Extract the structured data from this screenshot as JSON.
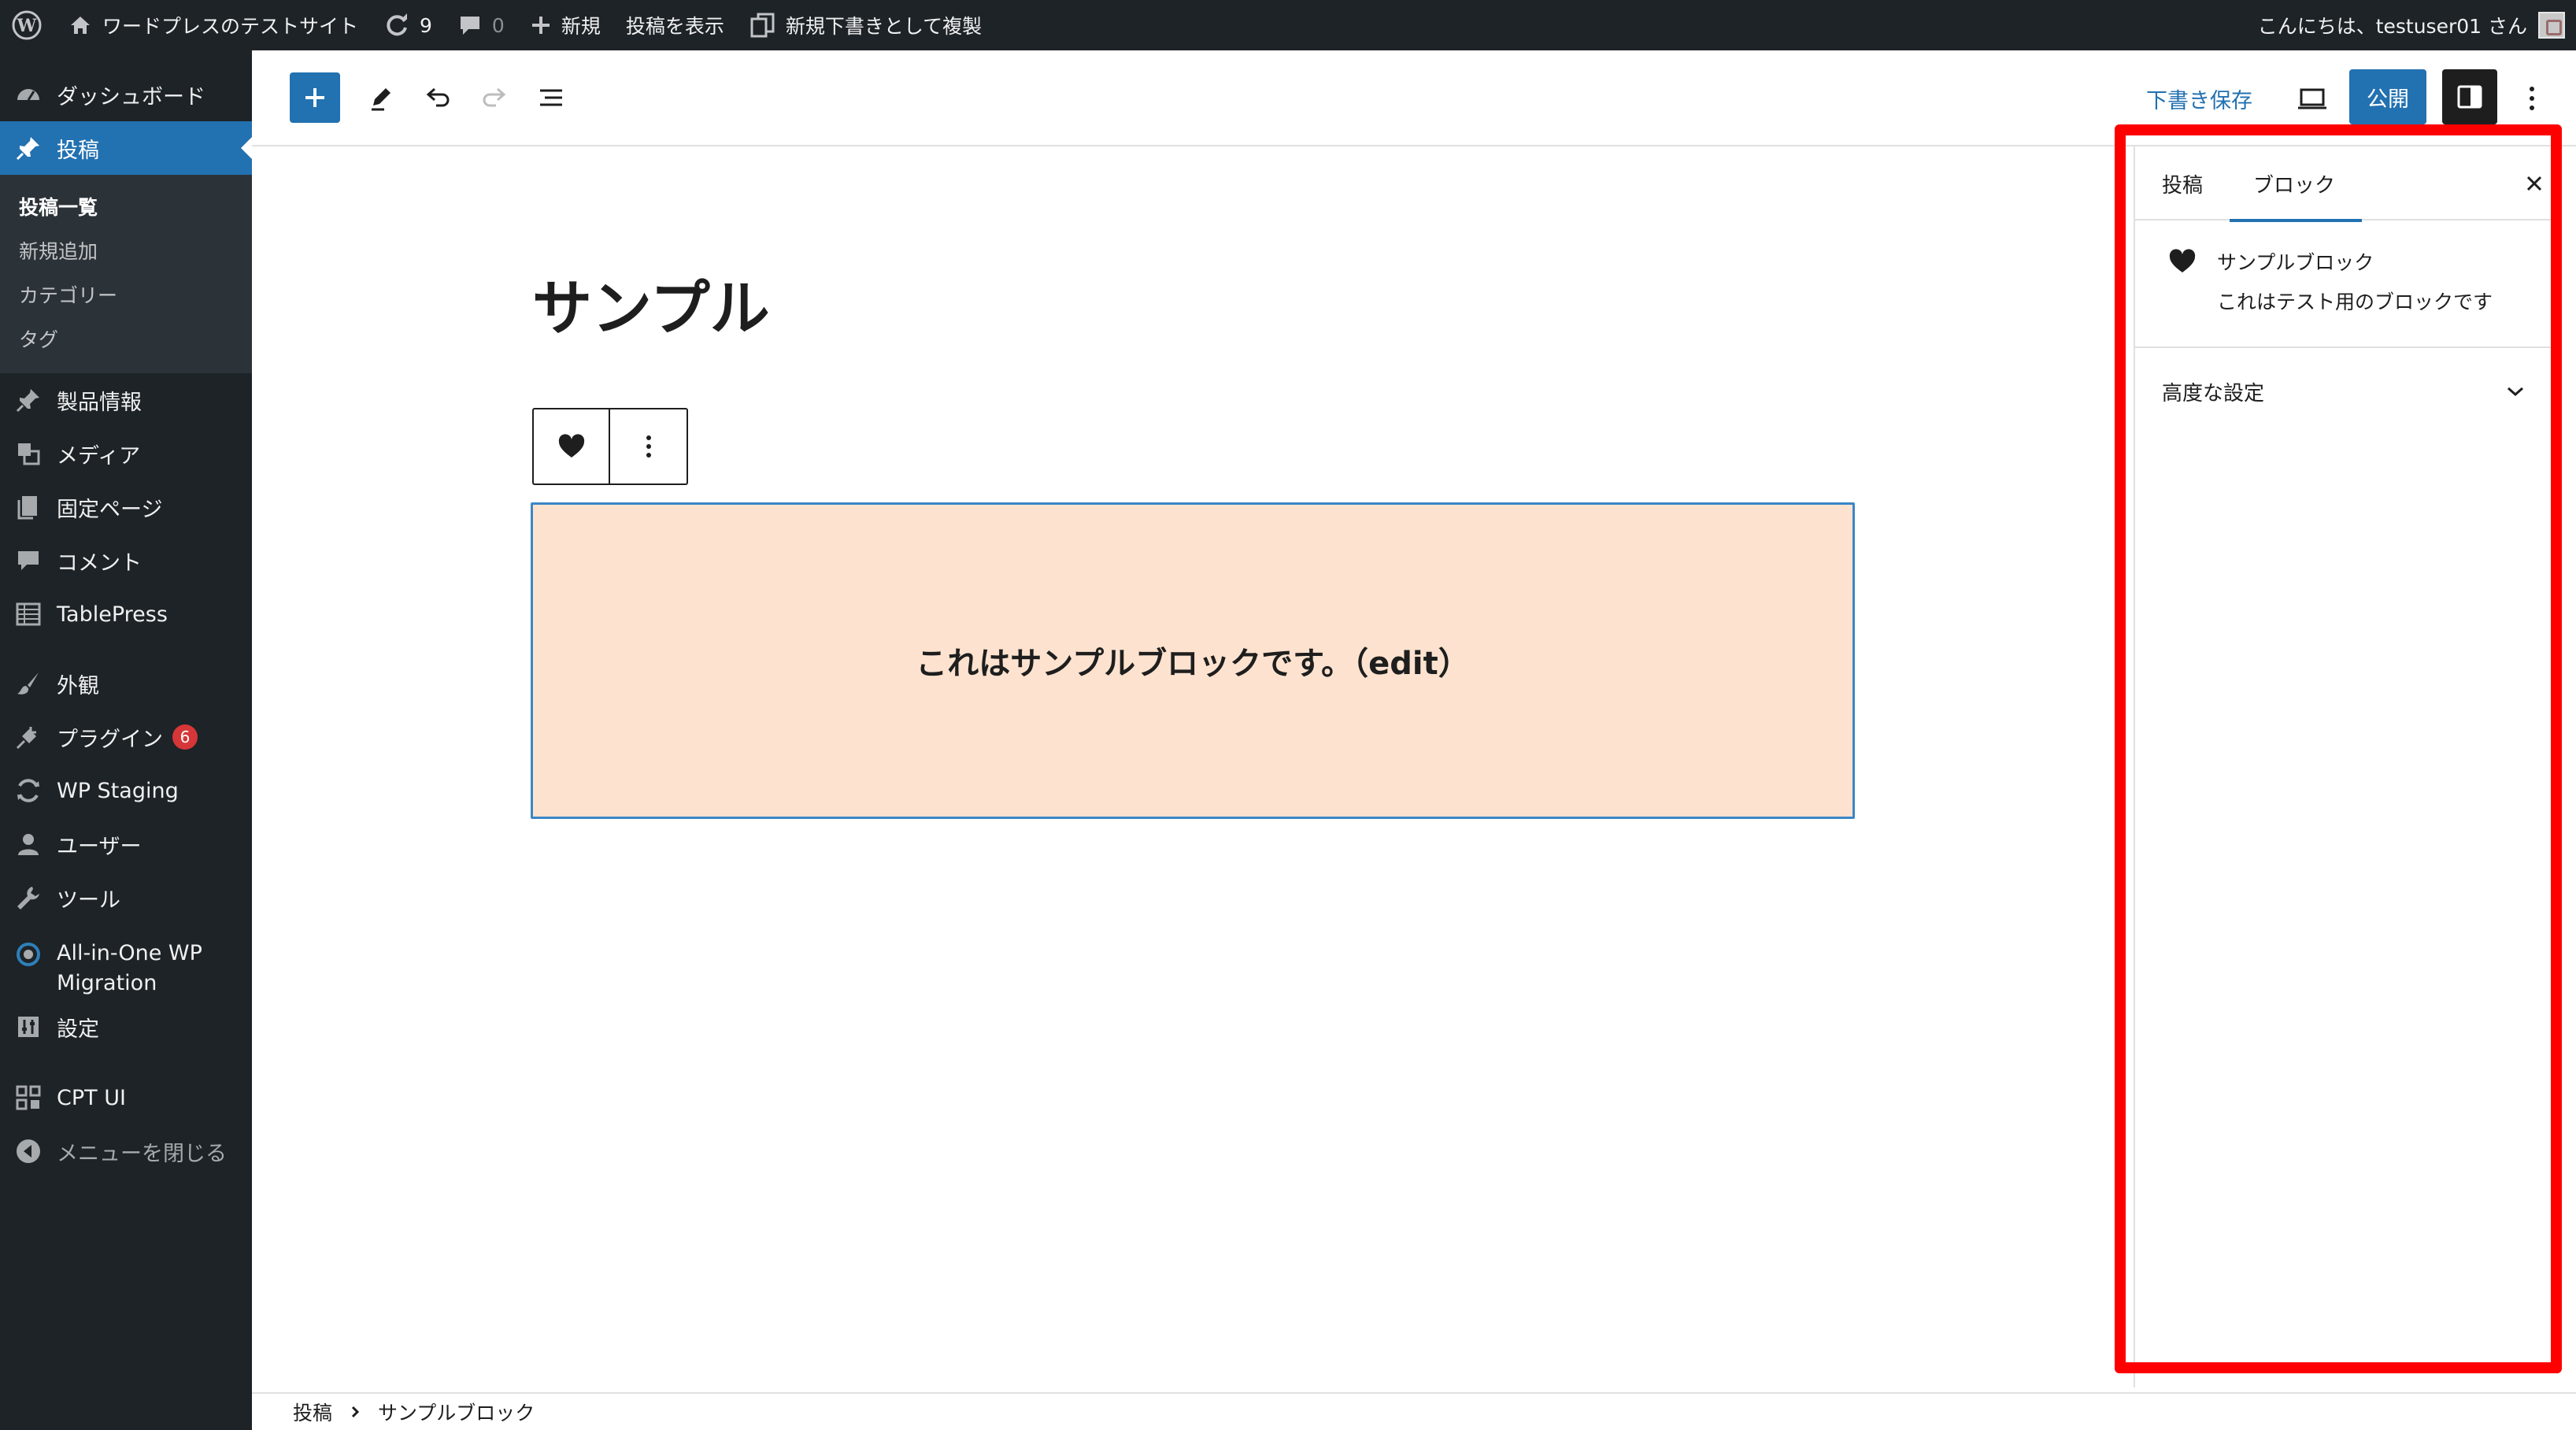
{
  "admin_bar": {
    "site_name": "ワードプレスのテストサイト",
    "updates_count": "9",
    "comments_count": "0",
    "new_label": "新規",
    "view_post": "投稿を表示",
    "duplicate_draft": "新規下書きとして複製",
    "greeting": "こんにちは、testuser01 さん"
  },
  "sidebar": {
    "dashboard": "ダッシュボード",
    "posts": "投稿",
    "submenu": [
      "投稿一覧",
      "新規追加",
      "カテゴリー",
      "タグ"
    ],
    "product_info": "製品情報",
    "media": "メディア",
    "pages": "固定ページ",
    "comments": "コメント",
    "tablepress": "TablePress",
    "appearance": "外観",
    "plugins": "プラグイン",
    "plugins_badge": "6",
    "wp_staging": "WP Staging",
    "users": "ユーザー",
    "tools": "ツール",
    "all_in_one_line1": "All-in-One WP",
    "all_in_one_line2": "Migration",
    "settings": "設定",
    "cpt_ui": "CPT UI",
    "collapse": "メニューを閉じる"
  },
  "editor_header": {
    "save_draft": "下書き保存",
    "publish": "公開"
  },
  "canvas": {
    "post_title": "サンプル",
    "block_text": "これはサンプルブロックです。（edit）"
  },
  "inspector": {
    "tab_post": "投稿",
    "tab_block": "ブロック",
    "block_title": "サンプルブロック",
    "block_description": "これはテスト用のブロックです",
    "advanced": "高度な設定"
  },
  "footer": {
    "crumb_root": "投稿",
    "crumb_block": "サンプルブロック"
  },
  "colors": {
    "accent": "#2271b1",
    "admin_bg": "#1d2327",
    "block_bg": "#fde3cf",
    "highlight": "#ff0000"
  }
}
